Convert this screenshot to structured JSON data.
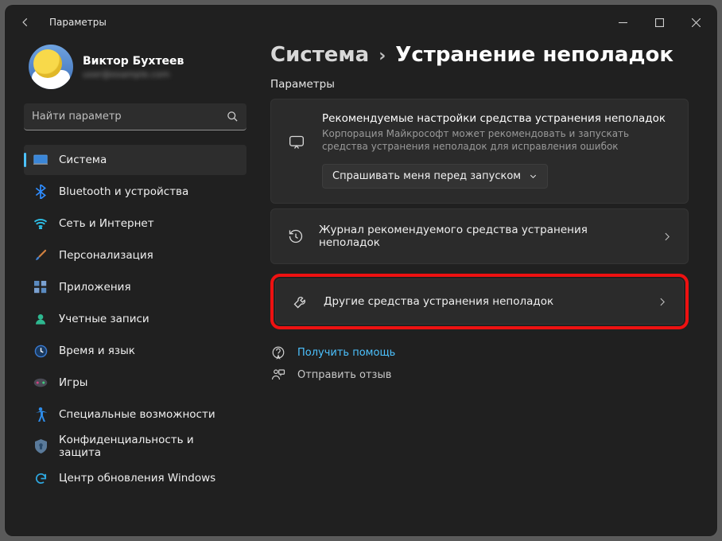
{
  "window": {
    "title": "Параметры"
  },
  "profile": {
    "name": "Виктор Бухтеев",
    "email": "user@example.com"
  },
  "search": {
    "placeholder": "Найти параметр"
  },
  "nav": {
    "items": [
      {
        "label": "Система"
      },
      {
        "label": "Bluetooth и устройства"
      },
      {
        "label": "Сеть и Интернет"
      },
      {
        "label": "Персонализация"
      },
      {
        "label": "Приложения"
      },
      {
        "label": "Учетные записи"
      },
      {
        "label": "Время и язык"
      },
      {
        "label": "Игры"
      },
      {
        "label": "Специальные возможности"
      },
      {
        "label": "Конфиденциальность и защита"
      },
      {
        "label": "Центр обновления Windows"
      }
    ]
  },
  "breadcrumb": {
    "parent": "Система",
    "sep": "›",
    "current": "Устранение неполадок"
  },
  "main": {
    "section_label": "Параметры",
    "reco_title": "Рекомендуемые настройки средства устранения неполадок",
    "reco_desc": "Корпорация Майкрософт может рекомендовать и запускать средства устранения неполадок для исправления ошибок",
    "dropdown_label": "Спрашивать меня перед запуском",
    "row_history": "Журнал рекомендуемого средства устранения неполадок",
    "row_other": "Другие средства устранения неполадок",
    "help": "Получить помощь",
    "feedback": "Отправить отзыв"
  }
}
